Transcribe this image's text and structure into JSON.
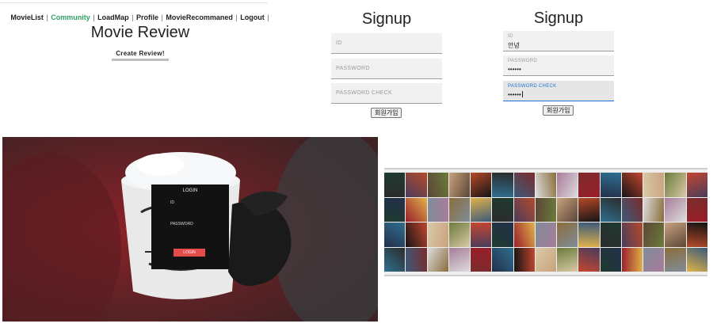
{
  "nav": {
    "items": [
      {
        "label": "MovieList",
        "active": false
      },
      {
        "label": "Community",
        "active": true
      },
      {
        "label": "LoadMap",
        "active": false
      },
      {
        "label": "Profile",
        "active": false
      },
      {
        "label": "MovieRecommaned",
        "active": false
      },
      {
        "label": "Logout",
        "active": false
      }
    ],
    "separator": "|"
  },
  "review": {
    "title": "Movie Review",
    "create_button": "Create Review!"
  },
  "signup_empty": {
    "title": "Signup",
    "id_placeholder": "ID",
    "password_placeholder": "PASSWORD",
    "password_check_placeholder": "PASSWORD CHECK",
    "submit_label": "회원가입"
  },
  "signup_filled": {
    "title": "Signup",
    "id_label": "ID",
    "id_value": "안녕",
    "password_label": "PASSWORD",
    "password_value": "••••••",
    "password_check_label": "PASSWORD CHECK",
    "password_check_value": "••••••",
    "submit_label": "회원가입"
  },
  "login": {
    "title": "LOGIN",
    "id_label": "ID",
    "password_label": "PASSWORD",
    "button_label": "LOGIN"
  },
  "colors": {
    "nav_active": "#2f9e61",
    "focus_blue": "#1d6fd6",
    "login_button": "#e54b4b",
    "poster_palette": [
      "#2b2b2b",
      "#c9a27e",
      "#3b5a7a",
      "#7a2c2c",
      "#d9c9a8",
      "#1e3b2f",
      "#8a6d3b",
      "#4a3c5c",
      "#b54a2a",
      "#dcdcdc",
      "#23304a",
      "#6b7b3a",
      "#9a1e2a",
      "#e0b24a",
      "#5b4636",
      "#2f6f8f",
      "#a87c9a",
      "#141414",
      "#c4462f",
      "#7f8c99"
    ]
  }
}
